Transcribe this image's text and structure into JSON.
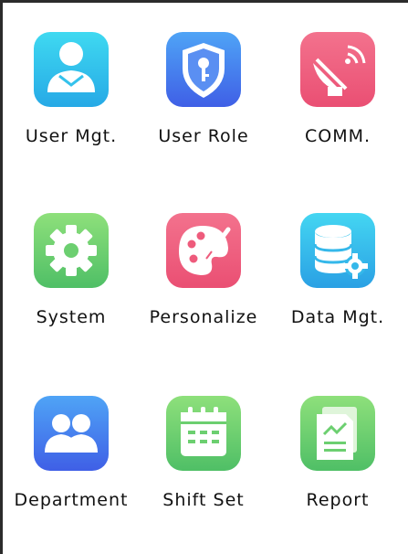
{
  "menu": {
    "items": [
      {
        "label": "User Mgt.",
        "icon": "user-mgt-icon",
        "color": "#2bb3e8"
      },
      {
        "label": "User Role",
        "icon": "user-role-shield-icon",
        "color": "#4a7cf0"
      },
      {
        "label": "COMM.",
        "icon": "comm-satellite-icon",
        "color": "#ee5b7c"
      },
      {
        "label": "System",
        "icon": "system-gear-icon",
        "color": "#5cc96c"
      },
      {
        "label": "Personalize",
        "icon": "personalize-palette-icon",
        "color": "#ee5b7c"
      },
      {
        "label": "Data Mgt.",
        "icon": "data-mgt-database-icon",
        "color": "#2bb3e8"
      },
      {
        "label": "Department",
        "icon": "department-users-icon",
        "color": "#4a7cf0"
      },
      {
        "label": "Shift Set",
        "icon": "shift-set-calendar-icon",
        "color": "#5cc96c"
      },
      {
        "label": "Report",
        "icon": "report-document-icon",
        "color": "#5cc96c"
      }
    ]
  }
}
